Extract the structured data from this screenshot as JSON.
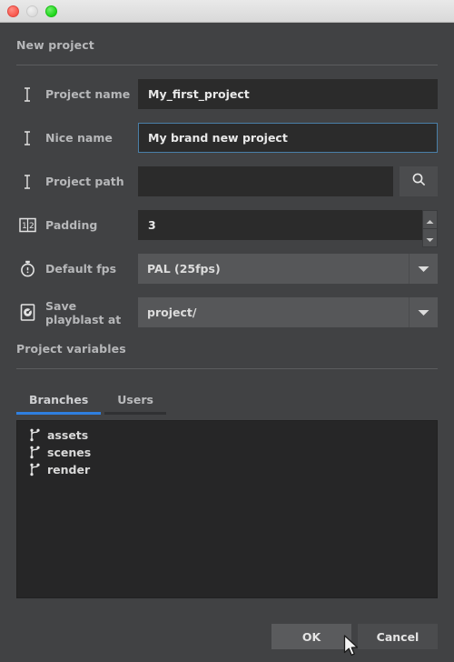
{
  "window": {
    "traffic_lights": [
      {
        "name": "close",
        "color": "#f8574c"
      },
      {
        "name": "minimize",
        "color": "#dcdcdc"
      },
      {
        "name": "maximize",
        "color": "#1ed61a"
      }
    ]
  },
  "sections": {
    "new_project_title": "New project",
    "project_variables_title": "Project variables"
  },
  "form": {
    "project_name": {
      "label": "Project name",
      "icon": "text-cursor-icon",
      "value": "My_first_project",
      "placeholder": ""
    },
    "nice_name": {
      "label": "Nice name",
      "icon": "text-cursor-icon",
      "value": "My brand new project",
      "placeholder": "",
      "focused": true
    },
    "project_path": {
      "label": "Project path",
      "icon": "text-cursor-icon",
      "value": "",
      "placeholder": "",
      "browse_icon": "search-icon"
    },
    "padding": {
      "label": "Padding",
      "icon": "number-padding-icon",
      "value": "3",
      "placeholder": ""
    },
    "default_fps": {
      "label": "Default fps",
      "icon": "stopwatch-icon",
      "value": "PAL (25fps)",
      "options": [
        "PAL (25fps)"
      ]
    },
    "save_playblast_at": {
      "label": "Save playblast at",
      "icon": "playblast-disc-icon",
      "value": "project/",
      "options": [
        "project/"
      ]
    }
  },
  "tabs": [
    {
      "label": "Branches",
      "active": true
    },
    {
      "label": "Users",
      "active": false
    }
  ],
  "branches_list": [
    {
      "label": "assets",
      "icon": "git-branch-icon"
    },
    {
      "label": "scenes",
      "icon": "git-branch-icon"
    },
    {
      "label": "render",
      "icon": "git-branch-icon"
    }
  ],
  "buttons": {
    "ok": "OK",
    "cancel": "Cancel"
  },
  "colors": {
    "background": "#414244",
    "field_background": "#2b2b2b",
    "combo_background": "#565759",
    "accent_blue": "#2f7fe0",
    "focus_border": "#4a7fa8",
    "text": "#b6b7b9",
    "list_background": "#262627"
  }
}
